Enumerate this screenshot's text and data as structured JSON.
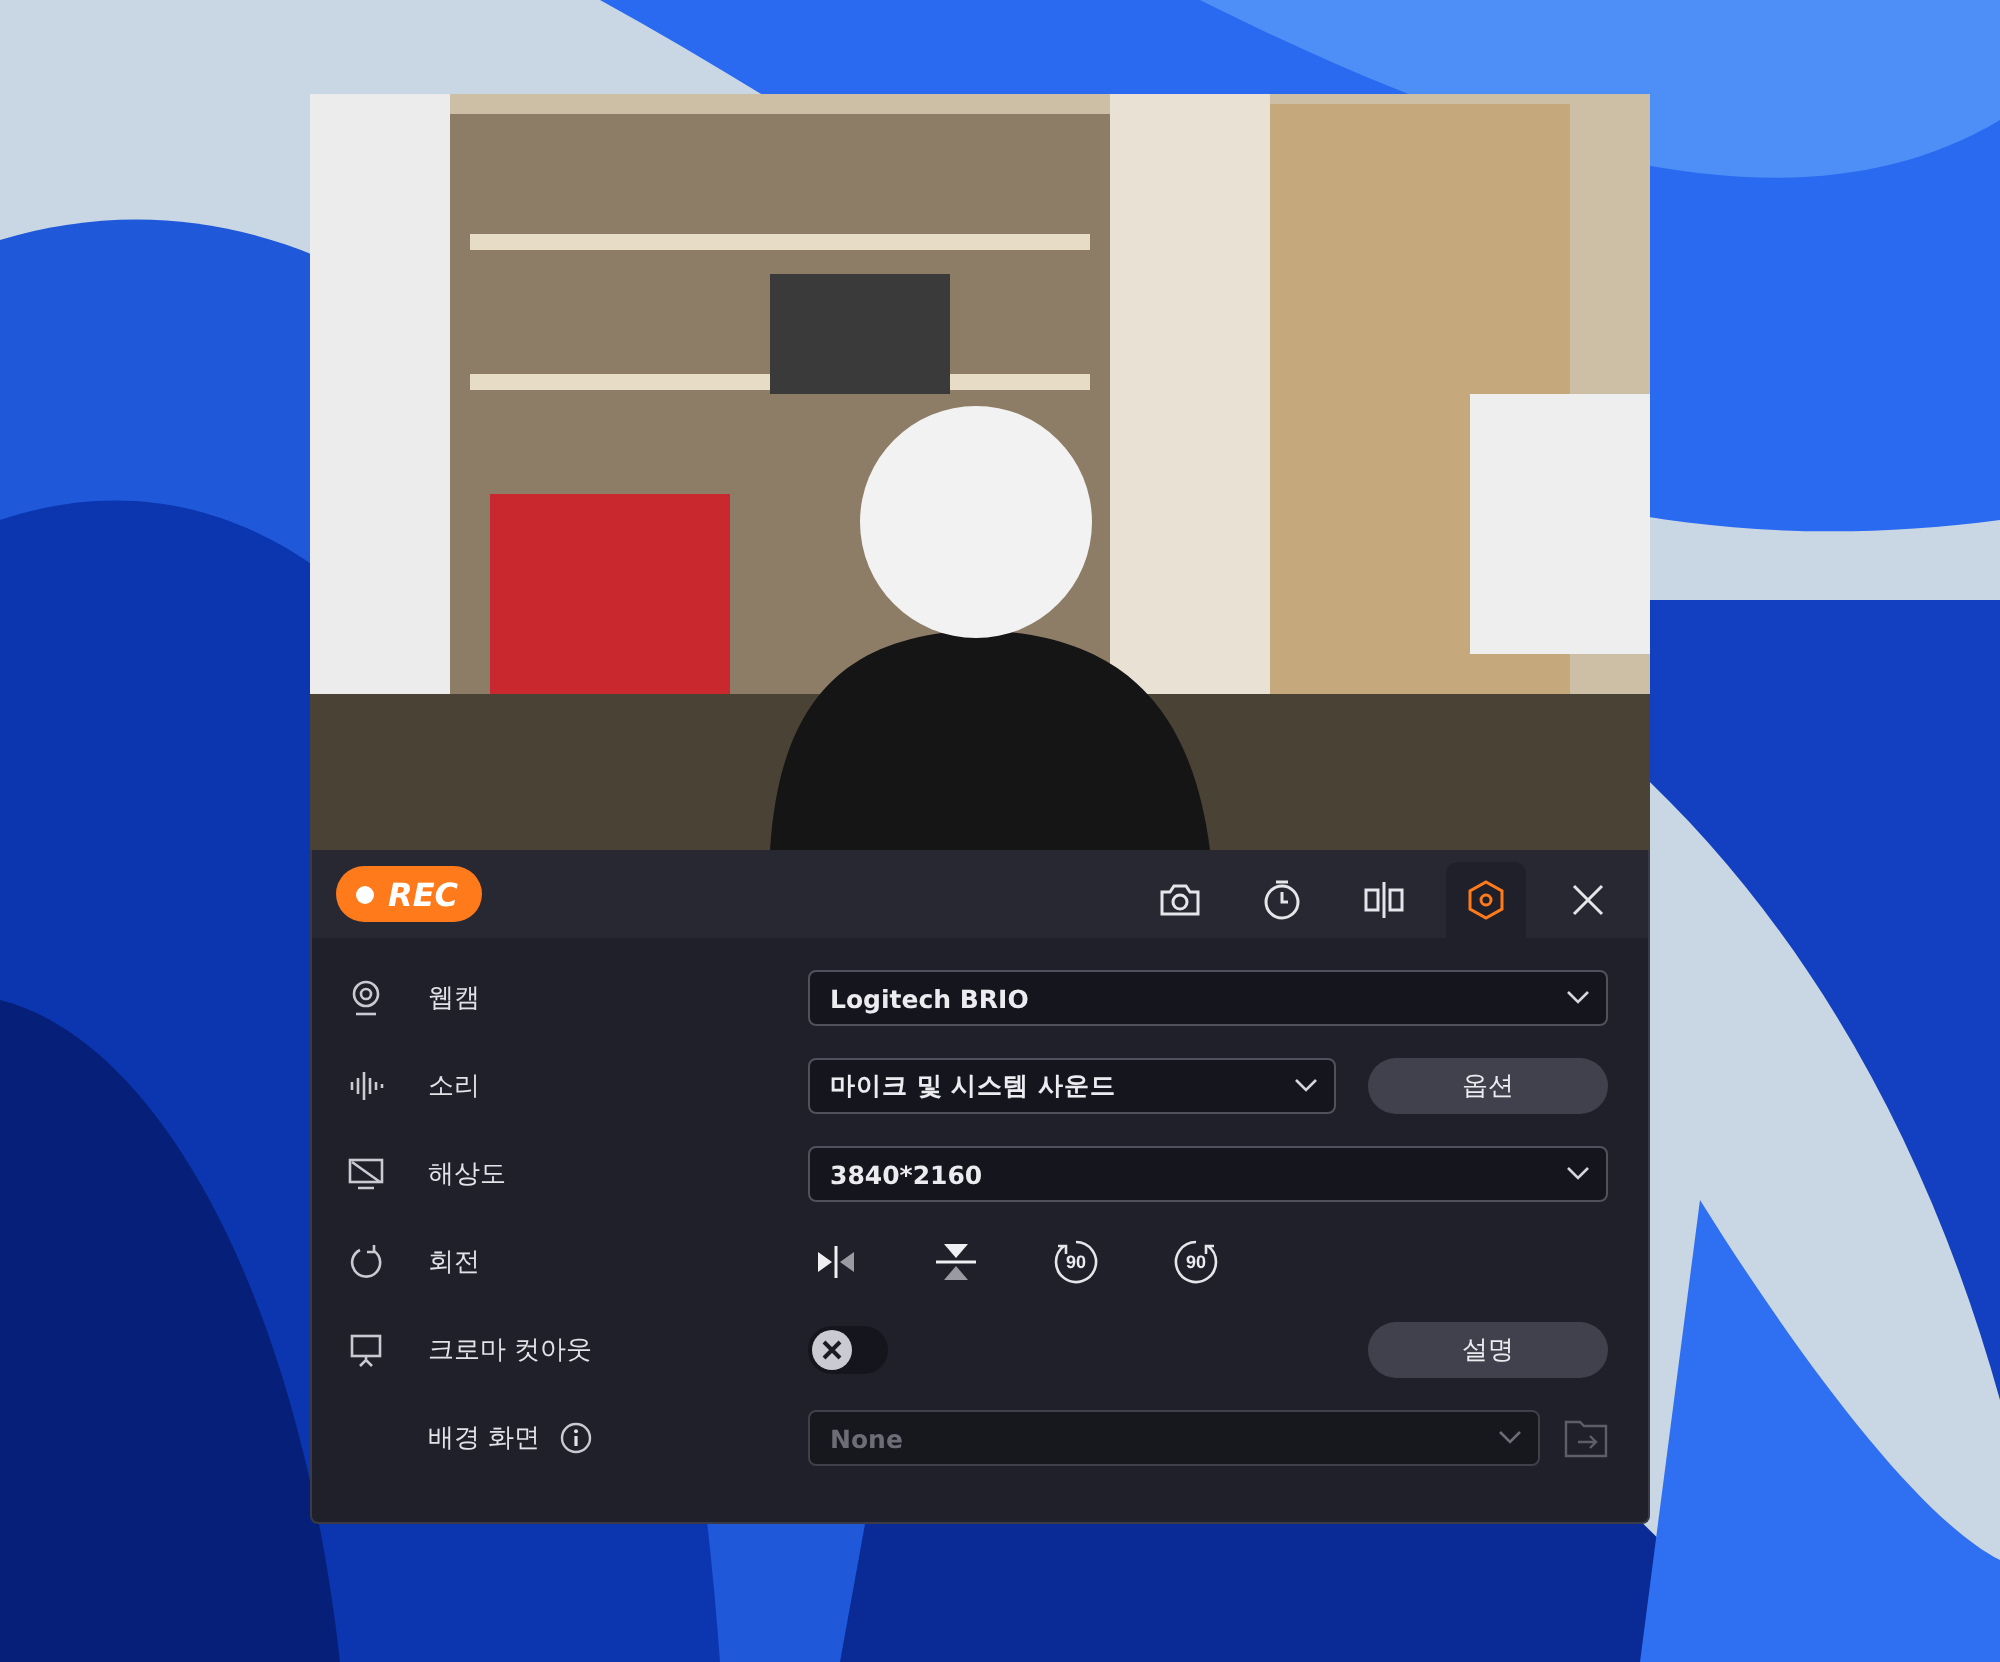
{
  "toolbar": {
    "rec_label": "REC",
    "tools": [
      {
        "kind": "camera",
        "selected": false
      },
      {
        "kind": "timer",
        "selected": false
      },
      {
        "kind": "split",
        "selected": false
      },
      {
        "kind": "settings",
        "selected": true
      },
      {
        "kind": "close",
        "selected": false
      }
    ]
  },
  "rows": [
    {
      "kind": "select",
      "label": "웹캠",
      "value": "Logitech BRIO"
    },
    {
      "kind": "select_button",
      "label": "소리",
      "value": "마이크 및 시스템 사운드",
      "button": "옵션"
    },
    {
      "kind": "select",
      "label": "해상도",
      "value": "3840*2160"
    },
    {
      "kind": "rotate",
      "label": "회전",
      "buttons": [
        {
          "kind": "flip_h"
        },
        {
          "kind": "flip_v"
        },
        {
          "kind": "rot_left",
          "label": "90"
        },
        {
          "kind": "rot_right",
          "label": "90"
        }
      ]
    },
    {
      "kind": "toggle_button",
      "label": "크로마 컷아웃",
      "on": false,
      "button": "설명"
    },
    {
      "kind": "select_folder",
      "label": "배경 화면",
      "value": "None",
      "disabled": true
    }
  ]
}
